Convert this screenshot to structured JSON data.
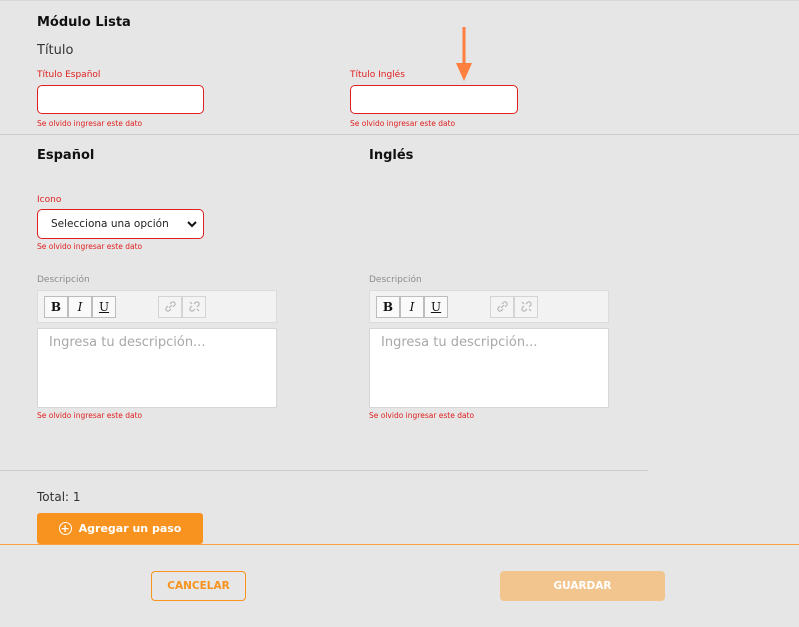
{
  "module": {
    "title": "Módulo Lista",
    "section_label": "Título"
  },
  "fields": {
    "title_es_label": "Título Español",
    "title_en_label": "Título Inglés",
    "error_text": "Se olvido ingresar este dato"
  },
  "columns": {
    "spanish_heading": "Español",
    "english_heading": "Inglés"
  },
  "icon_field": {
    "label": "Icono",
    "selected": "Selecciona una opción"
  },
  "description": {
    "label": "Descripción",
    "placeholder": "Ingresa tu descripción...",
    "toolbar": {
      "bold": "B",
      "italic": "I",
      "underline": "U"
    }
  },
  "footer": {
    "total": "Total: 1",
    "add_step": "Agregar un paso",
    "cancel": "CANCELAR",
    "save": "GUARDAR"
  },
  "colors": {
    "accent": "#f7931e",
    "error": "#e02020",
    "arrow": "#ff7f3f"
  },
  "icons": [
    "arrow-down-icon",
    "chevron-down-icon",
    "link-icon",
    "unlink-icon",
    "plus-circle-icon"
  ]
}
